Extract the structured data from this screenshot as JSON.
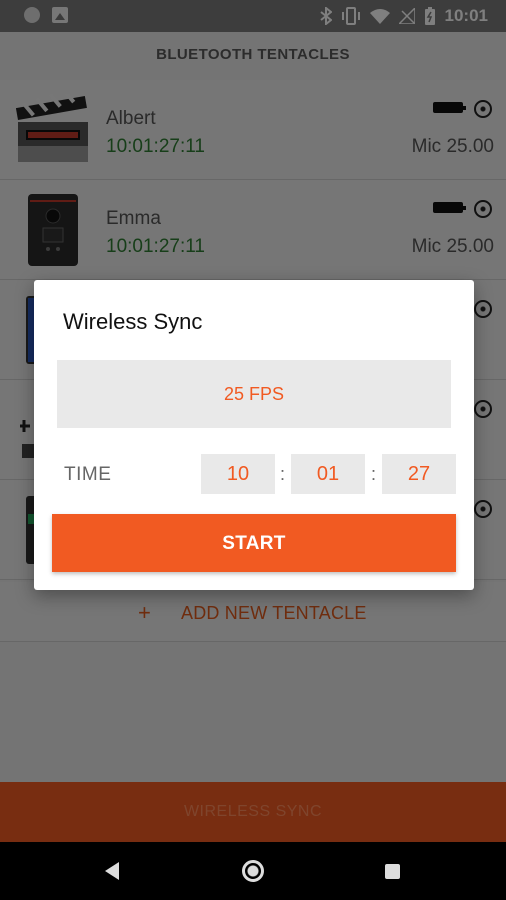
{
  "status_bar": {
    "time": "10:01",
    "icons": [
      "circle-icon",
      "image-icon",
      "bluetooth-icon",
      "vibrate-icon",
      "wifi-icon",
      "no-signal-icon",
      "battery-icon"
    ]
  },
  "app": {
    "title": "BLUETOOTH TENTACLES"
  },
  "tentacles": [
    {
      "name": "Albert",
      "timecode": "10:01:27:11",
      "mic": "Mic 25.00",
      "thumb": "clapperboard-icon"
    },
    {
      "name": "Emma",
      "timecode": "10:01:27:11",
      "mic": "Mic 25.00",
      "thumb": "recorder-icon"
    },
    {
      "name": "",
      "timecode": "",
      "mic": "",
      "thumb": "camera-icon"
    },
    {
      "name": "",
      "timecode": "",
      "mic": "",
      "thumb": "rig-icon"
    },
    {
      "name": "",
      "timecode": "",
      "mic": "",
      "thumb": "camera-icon"
    }
  ],
  "add_tentacle": {
    "plus": "+",
    "label": "ADD NEW TENTACLE"
  },
  "bottom_button": {
    "label": "WIRELESS SYNC"
  },
  "dialog": {
    "title": "Wireless Sync",
    "fps": "25 FPS",
    "time_label": "TIME",
    "hours": "10",
    "minutes": "01",
    "seconds": "27",
    "separator": ":",
    "start": "START"
  },
  "colors": {
    "accent": "#f15a22",
    "timecode": "#2e7d32"
  }
}
